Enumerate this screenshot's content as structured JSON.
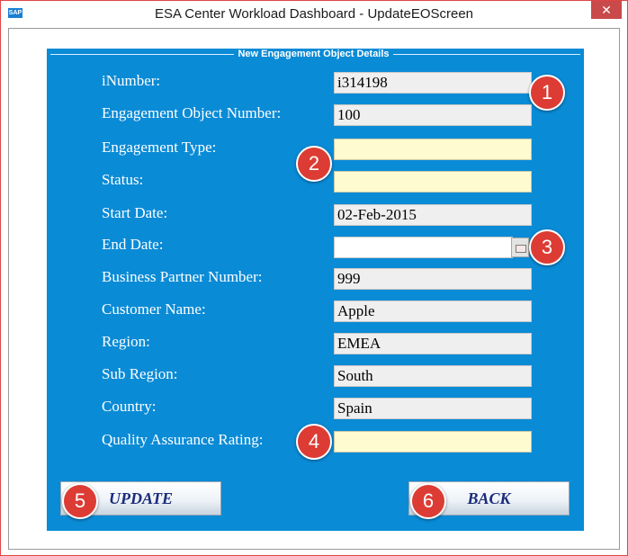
{
  "window": {
    "title": "ESA Center Workload Dashboard - UpdateEOScreen",
    "app_icon": "SAP",
    "close_label": "✕"
  },
  "group": {
    "title": "New Engagement Object Details"
  },
  "fields": {
    "inumber": {
      "label": "iNumber:",
      "value": "i314198"
    },
    "eo_number": {
      "label": "Engagement Object Number:",
      "value": "100"
    },
    "engagement_type": {
      "label": "Engagement Type:",
      "value": ""
    },
    "status": {
      "label": "Status:",
      "value": ""
    },
    "start_date": {
      "label": "Start Date:",
      "value": "02-Feb-2015"
    },
    "end_date": {
      "label": "End Date:",
      "value": ""
    },
    "bp_number": {
      "label": "Business Partner Number:",
      "value": "999"
    },
    "customer_name": {
      "label": "Customer Name:",
      "value": "Apple"
    },
    "region": {
      "label": "Region:",
      "value": "EMEA"
    },
    "sub_region": {
      "label": "Sub Region:",
      "value": "South"
    },
    "country": {
      "label": "Country:",
      "value": "Spain"
    },
    "qa_rating": {
      "label": "Quality Assurance Rating:",
      "value": ""
    }
  },
  "badges": [
    "1",
    "2",
    "3",
    "4",
    "5",
    "6"
  ],
  "buttons": {
    "update": "UPDATE",
    "back": "BACK"
  },
  "colors": {
    "panel": "#0a8bd6",
    "badge": "#dc3c34",
    "editable_field": "#fffbd0"
  }
}
